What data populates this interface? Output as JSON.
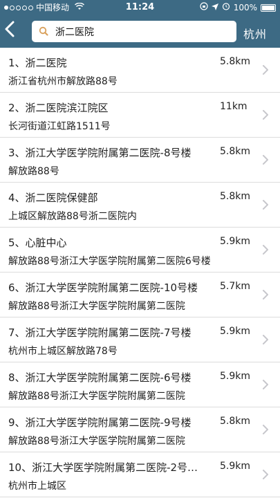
{
  "statusbar": {
    "carrier": "中国移动",
    "time": "11:24",
    "battery": "100%"
  },
  "search": {
    "query": "浙二医院",
    "city": "杭州"
  },
  "results": [
    {
      "title": "1、浙二医院",
      "distance": "5.8km",
      "address": "浙江省杭州市解放路88号"
    },
    {
      "title": "2、浙二医院滨江院区",
      "distance": "11km",
      "address": "长河街道江虹路1511号"
    },
    {
      "title": "3、浙江大学医学院附属第二医院-8号楼",
      "distance": "5.8km",
      "address": "解放路88号"
    },
    {
      "title": "4、浙二医院保健部",
      "distance": "5.8km",
      "address": "上城区解放路88号浙二医院内"
    },
    {
      "title": "5、心脏中心",
      "distance": "5.9km",
      "address": "解放路88号浙江大学医学院附属第二医院6号楼"
    },
    {
      "title": "6、浙江大学医学院附属第二医院-10号楼",
      "distance": "5.7km",
      "address": "解放路88号浙江大学医学院附属第二医院"
    },
    {
      "title": "7、浙江大学医学院附属第二医院-7号楼",
      "distance": "5.9km",
      "address": "杭州市上城区解放路78号"
    },
    {
      "title": "8、浙江大学医学院附属第二医院-6号楼",
      "distance": "5.9km",
      "address": "解放路88号浙江大学医学院附属第二医院"
    },
    {
      "title": "9、浙江大学医学院附属第二医院-9号楼",
      "distance": "5.8km",
      "address": "解放路88号浙江大学医学院附属第二医院"
    },
    {
      "title": "10、浙江大学医学院附属第二医院-2号…",
      "distance": "5.9km",
      "address": "杭州市上城区"
    }
  ],
  "colors": {
    "header": "#3d6a84",
    "chevron": "#c7c7cc",
    "divider": "#dcdcdc"
  }
}
